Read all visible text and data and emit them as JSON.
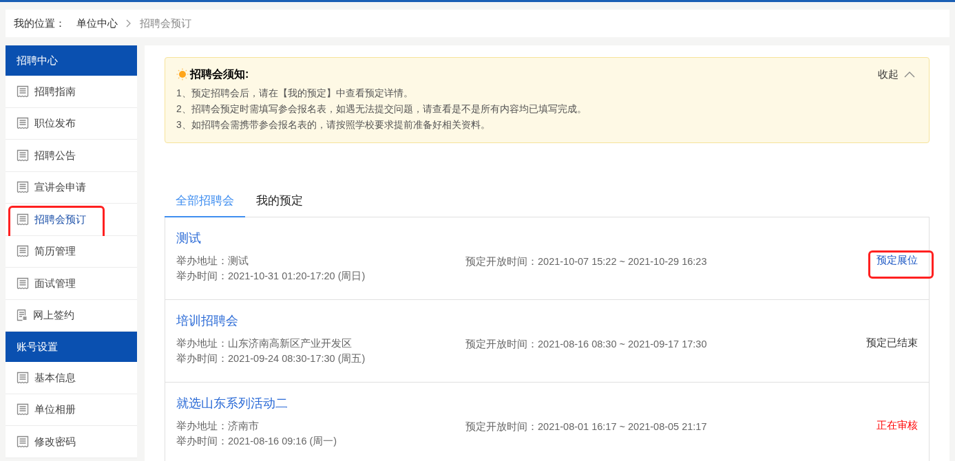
{
  "breadcrumb": {
    "label": "我的位置：",
    "items": [
      {
        "text": "单位中心",
        "current": false
      },
      {
        "text": "招聘会预订",
        "current": true
      }
    ]
  },
  "sidebar": {
    "sections": [
      {
        "title": "招聘中心",
        "items": [
          {
            "label": "招聘指南",
            "selected": false,
            "annotated": false,
            "kind": "doc"
          },
          {
            "label": "职位发布",
            "selected": false,
            "annotated": false,
            "kind": "doc"
          },
          {
            "label": "招聘公告",
            "selected": false,
            "annotated": false,
            "kind": "doc"
          },
          {
            "label": "宣讲会申请",
            "selected": false,
            "annotated": false,
            "kind": "doc"
          },
          {
            "label": "招聘会预订",
            "selected": true,
            "annotated": true,
            "kind": "doc"
          },
          {
            "label": "简历管理",
            "selected": false,
            "annotated": false,
            "kind": "doc"
          },
          {
            "label": "面试管理",
            "selected": false,
            "annotated": false,
            "kind": "doc"
          },
          {
            "label": "网上签约",
            "selected": false,
            "annotated": false,
            "kind": "contract"
          }
        ]
      },
      {
        "title": "账号设置",
        "items": [
          {
            "label": "基本信息",
            "selected": false,
            "annotated": false,
            "kind": "doc"
          },
          {
            "label": "单位相册",
            "selected": false,
            "annotated": false,
            "kind": "doc"
          },
          {
            "label": "修改密码",
            "selected": false,
            "annotated": false,
            "kind": "doc"
          }
        ]
      }
    ]
  },
  "notice": {
    "title": "招聘会须知:",
    "toggle": "收起",
    "expanded": true,
    "lines": [
      "1、预定招聘会后，请在【我的预定】中查看预定详情。",
      "2、招聘会预定时需填写参会报名表，如遇无法提交问题，请查看是不是所有内容均已填写完成。",
      "3、如招聘会需携带参会报名表的，请按照学校要求提前准备好相关资料。"
    ]
  },
  "tabs": [
    {
      "label": "全部招聘会",
      "selected": true
    },
    {
      "label": "我的预定",
      "selected": false
    }
  ],
  "fairs": [
    {
      "title": "测试",
      "address": "举办地址：测试",
      "time": "举办时间：2021-10-31 01:20-17:20 (周日)",
      "booking": "预定开放时间：2021-10-07 15:22 ~ 2021-10-29 16:23",
      "status": {
        "kind": "link",
        "text": "预定展位",
        "annotated": true
      }
    },
    {
      "title": "培训招聘会",
      "address": "举办地址：山东济南高新区产业开发区",
      "time": "举办时间：2021-09-24 08:30-17:30 (周五)",
      "booking": "预定开放时间：2021-08-16 08:30 ~ 2021-09-17 17:30",
      "status": {
        "kind": "ended",
        "text": "预定已结束",
        "annotated": false
      }
    },
    {
      "title": "就选山东系列活动二",
      "address": "举办地址：济南市",
      "time": "举办时间：2021-08-16 09:16 (周一)",
      "booking": "预定开放时间：2021-08-01 16:17 ~ 2021-08-05 21:17",
      "status": {
        "kind": "pending",
        "text": "正在审核",
        "annotated": false
      }
    }
  ]
}
